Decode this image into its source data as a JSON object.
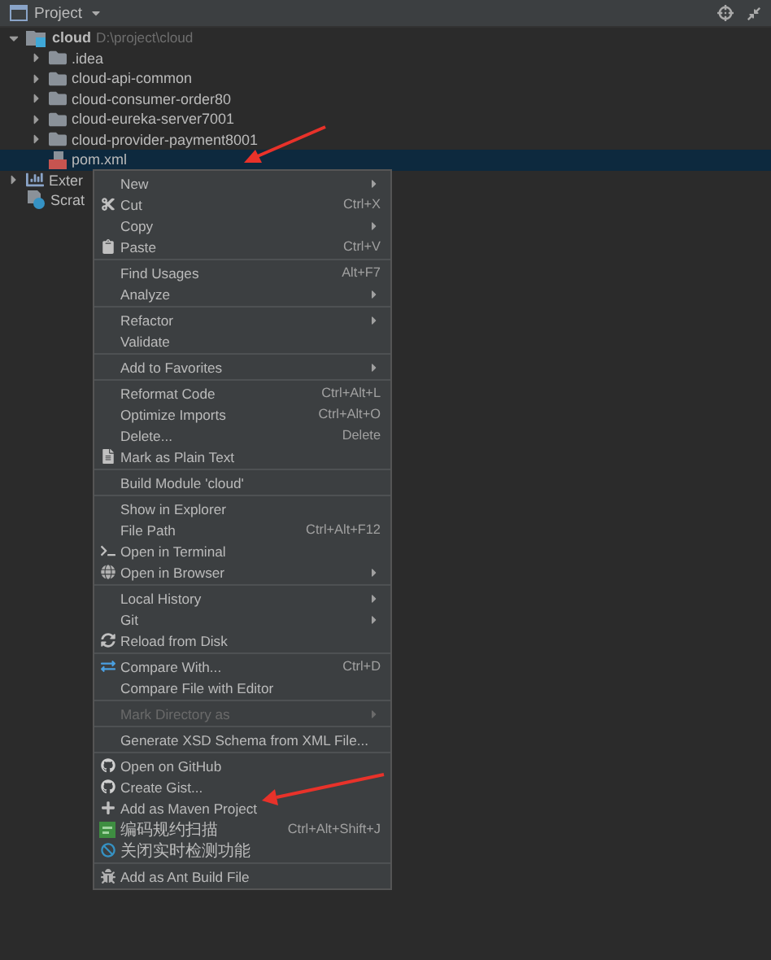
{
  "panel": {
    "title": "Project"
  },
  "tree": [
    {
      "label": "cloud",
      "path": "D:\\project\\cloud",
      "kind": "module",
      "expanded": true,
      "selected": false,
      "children": [
        {
          "label": ".idea",
          "kind": "folder",
          "expanded": false,
          "selected": false
        },
        {
          "label": "cloud-api-common",
          "kind": "folder",
          "expanded": false,
          "selected": false
        },
        {
          "label": "cloud-consumer-order80",
          "kind": "folder",
          "expanded": false,
          "selected": false
        },
        {
          "label": "cloud-eureka-server7001",
          "kind": "folder",
          "expanded": false,
          "selected": false
        },
        {
          "label": "cloud-provider-payment8001",
          "kind": "folder",
          "expanded": false,
          "selected": false
        },
        {
          "label": "pom.xml",
          "kind": "maven",
          "selected": true
        }
      ]
    },
    {
      "label": "Exter",
      "kind": "libraries",
      "expanded": false,
      "selected": false
    },
    {
      "label": "Scrat",
      "kind": "scratches",
      "selected": false
    }
  ],
  "context_menu": {
    "groups": [
      [
        {
          "label": "New",
          "submenu": true,
          "disabled": false
        },
        {
          "label": "Cut",
          "shortcut": "Ctrl+X",
          "submenu": false,
          "disabled": false
        },
        {
          "label": "Copy",
          "submenu": true,
          "disabled": false
        },
        {
          "label": "Paste",
          "shortcut": "Ctrl+V",
          "submenu": false,
          "disabled": false
        }
      ],
      [
        {
          "label": "Find Usages",
          "shortcut": "Alt+F7",
          "submenu": false,
          "disabled": false
        },
        {
          "label": "Analyze",
          "submenu": true,
          "disabled": false
        }
      ],
      [
        {
          "label": "Refactor",
          "submenu": true,
          "disabled": false
        },
        {
          "label": "Validate",
          "submenu": false,
          "disabled": false
        }
      ],
      [
        {
          "label": "Add to Favorites",
          "submenu": true,
          "disabled": false
        }
      ],
      [
        {
          "label": "Reformat Code",
          "shortcut": "Ctrl+Alt+L",
          "submenu": false,
          "disabled": false
        },
        {
          "label": "Optimize Imports",
          "shortcut": "Ctrl+Alt+O",
          "submenu": false,
          "disabled": false
        },
        {
          "label": "Delete...",
          "shortcut": "Delete",
          "submenu": false,
          "disabled": false
        },
        {
          "label": "Mark as Plain Text",
          "submenu": false,
          "disabled": false
        }
      ],
      [
        {
          "label": "Build Module 'cloud'",
          "submenu": false,
          "disabled": false
        }
      ],
      [
        {
          "label": "Show in Explorer",
          "submenu": false,
          "disabled": false
        },
        {
          "label": "File Path",
          "shortcut": "Ctrl+Alt+F12",
          "submenu": false,
          "disabled": false
        },
        {
          "label": "Open in Terminal",
          "submenu": false,
          "disabled": false
        },
        {
          "label": "Open in Browser",
          "submenu": true,
          "disabled": false
        }
      ],
      [
        {
          "label": "Local History",
          "submenu": true,
          "disabled": false
        },
        {
          "label": "Git",
          "submenu": true,
          "disabled": false
        },
        {
          "label": "Reload from Disk",
          "submenu": false,
          "disabled": false
        }
      ],
      [
        {
          "label": "Compare With...",
          "shortcut": "Ctrl+D",
          "submenu": false,
          "disabled": false
        },
        {
          "label": "Compare File with Editor",
          "submenu": false,
          "disabled": false
        }
      ],
      [
        {
          "label": "Mark Directory as",
          "submenu": true,
          "disabled": true
        }
      ],
      [
        {
          "label": "Generate XSD Schema from XML File...",
          "submenu": false,
          "disabled": false
        }
      ],
      [
        {
          "label": "Open on GitHub",
          "submenu": false,
          "disabled": false
        },
        {
          "label": "Create Gist...",
          "submenu": false,
          "disabled": false
        },
        {
          "label": "Add as Maven Project",
          "submenu": false,
          "disabled": false
        },
        {
          "label": "编码规约扫描",
          "shortcut": "Ctrl+Alt+Shift+J",
          "submenu": false,
          "disabled": false
        },
        {
          "label": "关闭实时检测功能",
          "submenu": false,
          "disabled": false
        }
      ],
      [
        {
          "label": "Add as Ant Build File",
          "submenu": false,
          "disabled": false
        }
      ]
    ]
  }
}
